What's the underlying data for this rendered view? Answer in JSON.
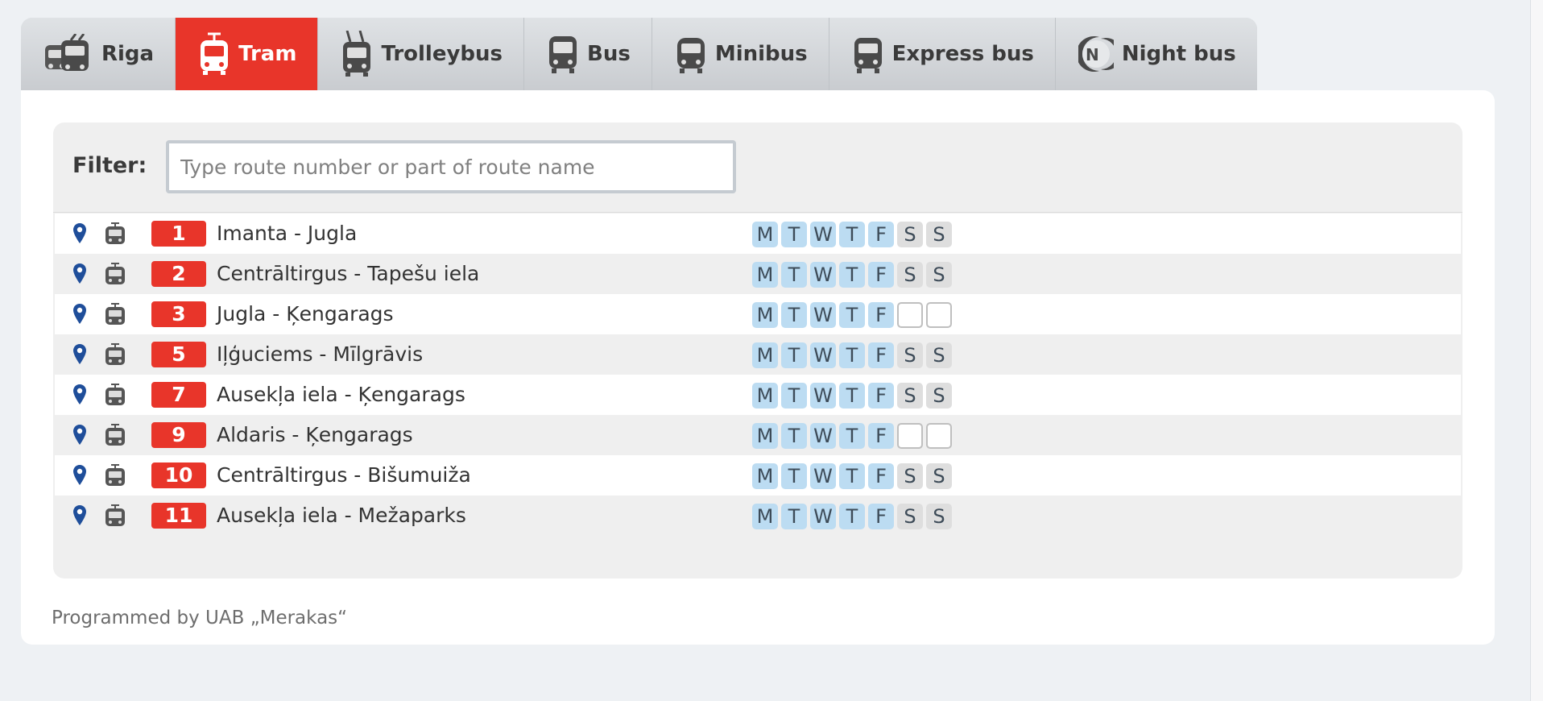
{
  "tabs": [
    {
      "label": "Riga",
      "icon": "riga-vehicles-icon",
      "active": false
    },
    {
      "label": "Tram",
      "icon": "tram-icon",
      "active": true
    },
    {
      "label": "Trolleybus",
      "icon": "trolleybus-icon",
      "active": false
    },
    {
      "label": "Bus",
      "icon": "bus-icon",
      "active": false
    },
    {
      "label": "Minibus",
      "icon": "minibus-icon",
      "active": false
    },
    {
      "label": "Express bus",
      "icon": "express-bus-icon",
      "active": false
    },
    {
      "label": "Night bus",
      "icon": "night-bus-icon",
      "active": false
    }
  ],
  "filter": {
    "label": "Filter:",
    "placeholder": "Type route number or part of route name",
    "value": ""
  },
  "routes": [
    {
      "number": "1",
      "name": "Imanta - Jugla",
      "days": [
        "M",
        "T",
        "W",
        "T",
        "F",
        "S",
        "S"
      ],
      "weekend_active": true
    },
    {
      "number": "2",
      "name": "Centrāltirgus - Tapešu iela",
      "days": [
        "M",
        "T",
        "W",
        "T",
        "F",
        "S",
        "S"
      ],
      "weekend_active": true
    },
    {
      "number": "3",
      "name": "Jugla - Ķengarags",
      "days": [
        "M",
        "T",
        "W",
        "T",
        "F",
        "",
        ""
      ],
      "weekend_active": false
    },
    {
      "number": "5",
      "name": "Iļģuciems - Mīlgrāvis",
      "days": [
        "M",
        "T",
        "W",
        "T",
        "F",
        "S",
        "S"
      ],
      "weekend_active": true
    },
    {
      "number": "7",
      "name": "Ausekļa iela - Ķengarags",
      "days": [
        "M",
        "T",
        "W",
        "T",
        "F",
        "S",
        "S"
      ],
      "weekend_active": true
    },
    {
      "number": "9",
      "name": "Aldaris - Ķengarags",
      "days": [
        "M",
        "T",
        "W",
        "T",
        "F",
        "",
        ""
      ],
      "weekend_active": false
    },
    {
      "number": "10",
      "name": "Centrāltirgus - Bišumuiža",
      "days": [
        "M",
        "T",
        "W",
        "T",
        "F",
        "S",
        "S"
      ],
      "weekend_active": true
    },
    {
      "number": "11",
      "name": "Ausekļa iela - Mežaparks",
      "days": [
        "M",
        "T",
        "W",
        "T",
        "F",
        "S",
        "S"
      ],
      "weekend_active": true
    }
  ],
  "footer": {
    "text": "Programmed by UAB „Merakas“"
  },
  "colors": {
    "accent": "#e8352a",
    "weekday": "#bcdcf2",
    "weekend": "#dedede",
    "pin": "#1f4e9a"
  }
}
